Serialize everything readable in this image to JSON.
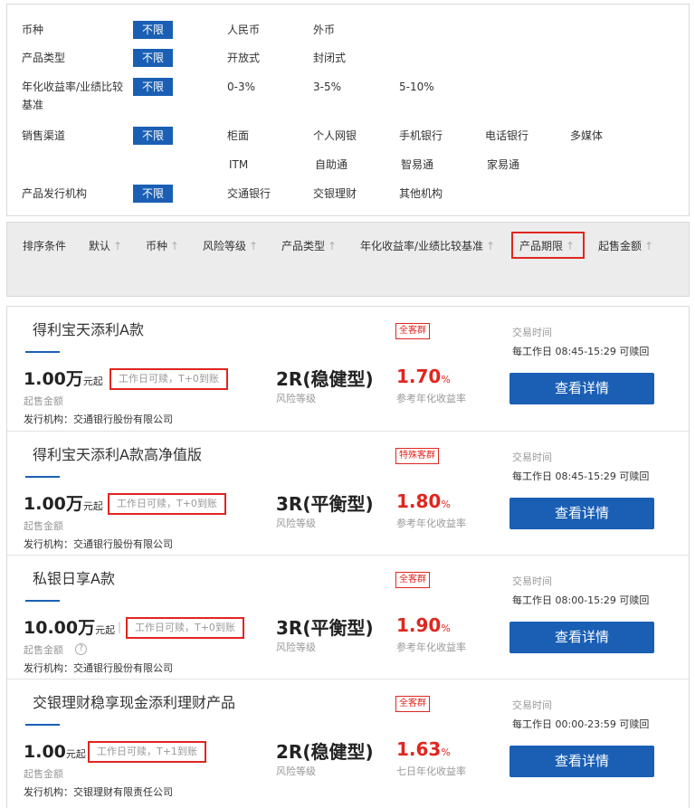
{
  "filters": {
    "currency": {
      "label": "币种",
      "unlimited": "不限",
      "options": [
        "人民币",
        "外币"
      ]
    },
    "product_type": {
      "label": "产品类型",
      "unlimited": "不限",
      "options": [
        "开放式",
        "封闭式"
      ]
    },
    "yield": {
      "label_line1": "年化收益率/业绩比较",
      "label_line2": "基准",
      "unlimited": "不限",
      "options": [
        "0-3%",
        "3-5%",
        "5-10%"
      ]
    },
    "channel": {
      "label": "销售渠道",
      "unlimited": "不限",
      "options_row1": [
        "柜面",
        "个人网银",
        "手机银行",
        "电话银行",
        "多媒体"
      ],
      "options_row2": [
        "ITM",
        "自助通",
        "智易通",
        "家易通"
      ]
    },
    "issuer": {
      "label": "产品发行机构",
      "unlimited": "不限",
      "options": [
        "交通银行",
        "交银理财",
        "其他机构"
      ]
    }
  },
  "sort": {
    "label": "排序条件",
    "items": [
      "默认",
      "币种",
      "风险等级",
      "产品类型",
      "年化收益率/业绩比较基准",
      "产品期限",
      "起售金额"
    ],
    "arrow": "↑"
  },
  "products": [
    {
      "name": "得利宝天添利A款",
      "badge": "全客群",
      "amount": "1.00万",
      "amount_unit": "元起",
      "redeem": "工作日可赎，T+0到账",
      "min_label": "起售金额",
      "issuer": "发行机构：交通银行股份有限公司",
      "risk": "2R(稳健型)",
      "risk_label": "风险等级",
      "rate": "1.70",
      "rate_pct": "%",
      "rate_label": "参考年化收益率",
      "time_label": "交易时间",
      "time": "每工作日 08:45-15:29  可赎回",
      "button": "查看详情"
    },
    {
      "name": "得利宝天添利A款高净值版",
      "badge": "特殊客群",
      "amount": "1.00万",
      "amount_unit": "元起",
      "redeem": "工作日可赎，T+0到账",
      "min_label": "起售金额",
      "issuer": "发行机构：交通银行股份有限公司",
      "risk": "3R(平衡型)",
      "risk_label": "风险等级",
      "rate": "1.80",
      "rate_pct": "%",
      "rate_label": "参考年化收益率",
      "time_label": "交易时间",
      "time": "每工作日 08:45-15:29  可赎回",
      "button": "查看详情"
    },
    {
      "name": "私银日享A款",
      "badge": "全客群",
      "amount": "10.00万",
      "amount_unit": "元起",
      "separator": "|",
      "redeem": "工作日可赎，T+0到账",
      "min_label": "起售金额",
      "help": "?",
      "issuer": "发行机构：交通银行股份有限公司",
      "risk": "3R(平衡型)",
      "risk_label": "风险等级",
      "rate": "1.90",
      "rate_pct": "%",
      "rate_label": "参考年化收益率",
      "time_label": "交易时间",
      "time": "每工作日 08:00-15:29  可赎回",
      "button": "查看详情"
    },
    {
      "name": "交银理财稳享现金添利理财产品",
      "badge": "全客群",
      "amount": "1.00",
      "amount_unit": "元起",
      "redeem": "工作日可赎，T+1到账",
      "min_label": "起售金额",
      "issuer": "发行机构：交银理财有限责任公司",
      "risk": "2R(稳健型)",
      "risk_label": "风险等级",
      "rate": "1.63",
      "rate_pct": "%",
      "rate_label": "七日年化收益率",
      "time_label": "交易时间",
      "time": "每工作日 00:00-23:59  可赎回",
      "button": "查看详情"
    }
  ],
  "colors": {
    "primary": "#1a5fb4",
    "accent_red": "#e0261f",
    "sort_bg": "#ececec"
  }
}
